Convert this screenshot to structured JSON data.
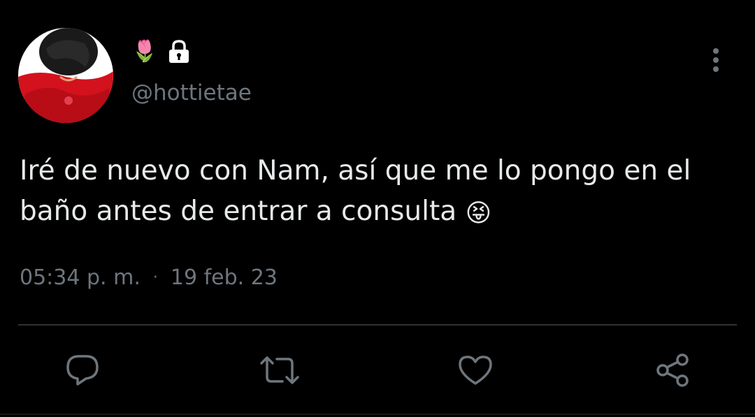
{
  "user": {
    "name_emoji": "🌷",
    "handle": "@hottietae",
    "protected_icon": "lock-icon",
    "avatar_icon": "profile-photo"
  },
  "tweet": {
    "text": "Iré de nuevo con Nam, así que me lo pongo en el baño antes de entrar a consulta",
    "emoji": "😝",
    "time": "05:34 p. m.",
    "separator": "·",
    "date": "19 feb. 23"
  },
  "actions": {
    "reply_icon": "reply-icon",
    "retweet_icon": "retweet-icon",
    "like_icon": "heart-icon",
    "share_icon": "share-icon"
  },
  "colors": {
    "background": "#000000",
    "text": "#e7e9ea",
    "secondary": "#6e767d",
    "divider": "#2f3336"
  }
}
